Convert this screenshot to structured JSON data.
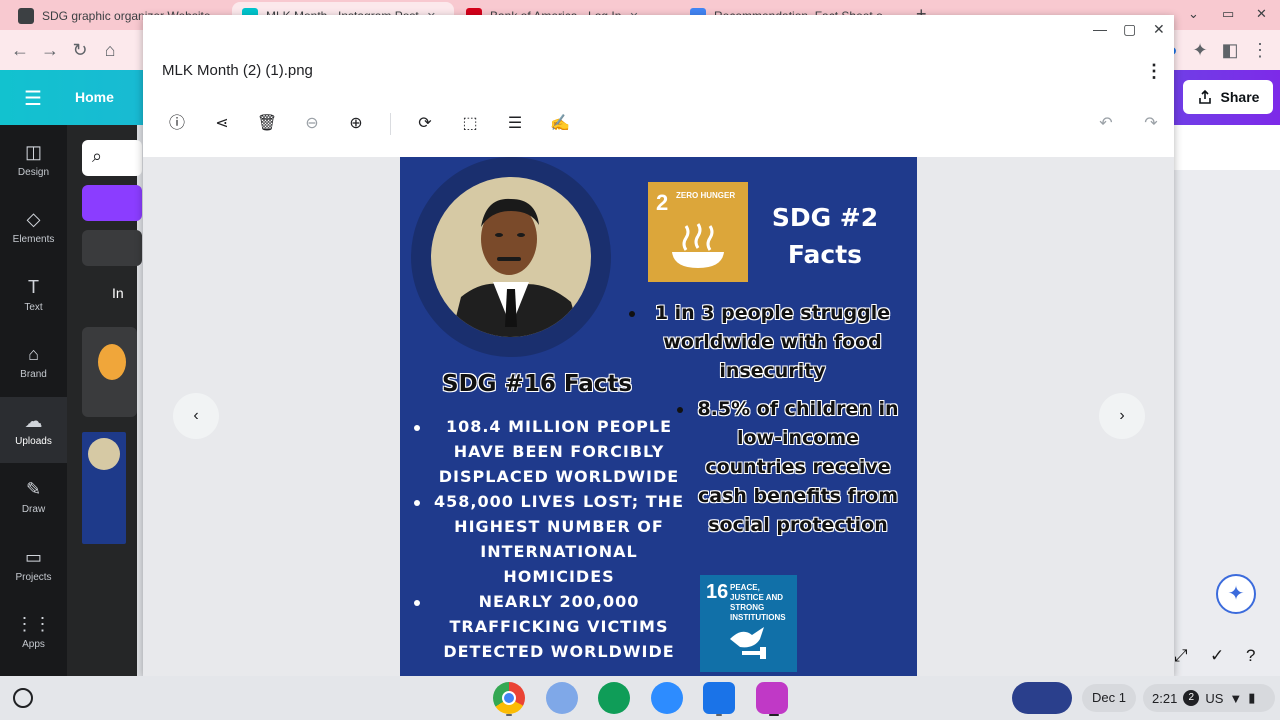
{
  "browser": {
    "tabs": [
      {
        "title": "SDG graphic organizer Website ...",
        "color": "#3c4043"
      },
      {
        "title": "MLK Month - Instagram Post",
        "color": "#00c4cc"
      },
      {
        "title": "Bank of America - Log In",
        "color": "#d4001a"
      },
      {
        "title": "Recommendation, Fact Sheet o...",
        "color": "#4285f4"
      }
    ],
    "new_tab": "+",
    "window_minimize": "⌄",
    "window_restore": "▭",
    "window_close": "✕"
  },
  "canva": {
    "home_label": "Home",
    "share_label": "Share",
    "side_tab_label": "In",
    "nav": [
      {
        "label": "Design",
        "icon": "◫"
      },
      {
        "label": "Elements",
        "icon": "◇"
      },
      {
        "label": "Text",
        "icon": "T"
      },
      {
        "label": "Brand",
        "icon": "⌂"
      },
      {
        "label": "Uploads",
        "icon": "☁"
      },
      {
        "label": "Draw",
        "icon": "✎"
      },
      {
        "label": "Projects",
        "icon": "▭"
      },
      {
        "label": "Apps",
        "icon": "⋮⋮"
      }
    ]
  },
  "gallery": {
    "file_name": "MLK Month (2) (1).png",
    "kebab": "⋮",
    "prev": "‹",
    "next": "›"
  },
  "poster": {
    "sdg2_number": "2",
    "sdg2_label": "ZERO HUNGER",
    "sdg2_title": "SDG #2 Facts",
    "sdg2_facts": [
      "1 in 3 people struggle worldwide with food insecurity",
      "8.5% of children in low-income countries receive cash benefits from social protection"
    ],
    "sdg16_title": "SDG #16 Facts",
    "sdg16_facts": [
      "108.4 MILLION PEOPLE HAVE BEEN FORCIBLY DISPLACED WORLDWIDE",
      "458,000 LIVES LOST; THE HIGHEST NUMBER OF INTERNATIONAL HOMICIDES",
      "NEARLY 200,000 TRAFFICKING VICTIMS DETECTED WORLDWIDE"
    ],
    "sdg16_number": "16",
    "sdg16_label": "PEACE, JUSTICE AND STRONG INSTITUTIONS"
  },
  "shelf": {
    "date": "Dec 1",
    "time": "2:21",
    "notifications": "2",
    "locale": "US"
  }
}
